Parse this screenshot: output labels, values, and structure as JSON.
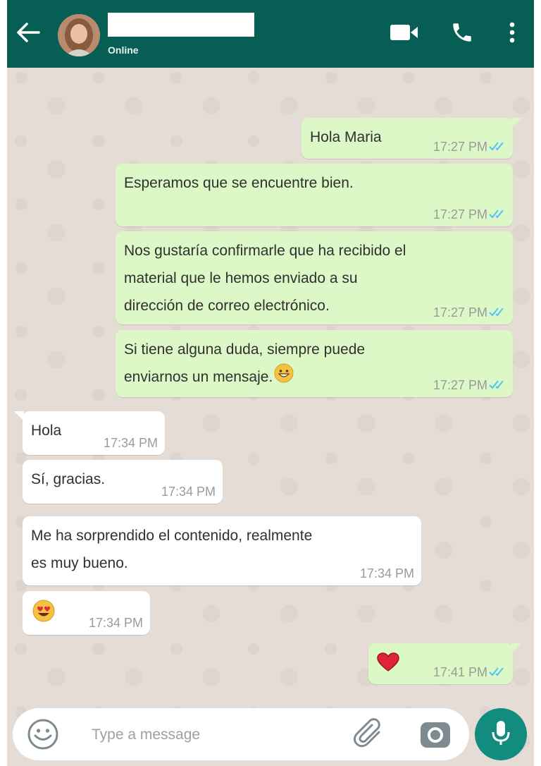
{
  "header": {
    "status": "Online",
    "icons": [
      "back-arrow-icon",
      "avatar",
      "video-call-icon",
      "phone-icon",
      "more-options-icon"
    ]
  },
  "messages": [
    {
      "direction": "outgoing",
      "text": "Hola Maria",
      "time": "17:27 PM",
      "ticks": "double-check-blue"
    },
    {
      "direction": "outgoing",
      "text": "Esperamos que se encuentre bien.",
      "time": "17:27 PM",
      "ticks": "double-check-blue"
    },
    {
      "direction": "outgoing",
      "lines": [
        "Nos gustaría confirmarle que ha recibido el",
        "material que le hemos enviado a su",
        "dirección de correo electrónico."
      ],
      "time": "17:27 PM",
      "ticks": "double-check-blue"
    },
    {
      "direction": "outgoing",
      "lines": [
        "Si tiene alguna duda, siempre puede",
        "enviarnos un mensaje."
      ],
      "emoji": "grinning-face-emoji",
      "time": "17:27 PM",
      "ticks": "double-check-blue"
    },
    {
      "direction": "incoming",
      "text": "Hola",
      "time": "17:34 PM"
    },
    {
      "direction": "incoming",
      "text": "Sí, gracias.",
      "time": "17:34 PM"
    },
    {
      "direction": "incoming",
      "lines": [
        "Me ha sorprendido el contenido, realmente",
        "es muy bueno."
      ],
      "time": "17:34 PM"
    },
    {
      "direction": "incoming",
      "emoji": "heart-eyes-emoji",
      "time": "17:34 PM"
    },
    {
      "direction": "outgoing",
      "emoji": "red-heart-emoji",
      "time": "17:41 PM",
      "ticks": "double-check-blue"
    }
  ],
  "composer": {
    "placeholder": "Type a message",
    "icons": [
      "emoji-icon",
      "attach-icon",
      "camera-icon",
      "microphone-icon"
    ]
  },
  "colors": {
    "header": "#075e54",
    "outgoing_bubble": "#dcf8c6",
    "incoming_bubble": "#ffffff",
    "chat_background": "#e5ddd5",
    "read_ticks": "#4fc3f7",
    "mic_button": "#128c7e"
  }
}
